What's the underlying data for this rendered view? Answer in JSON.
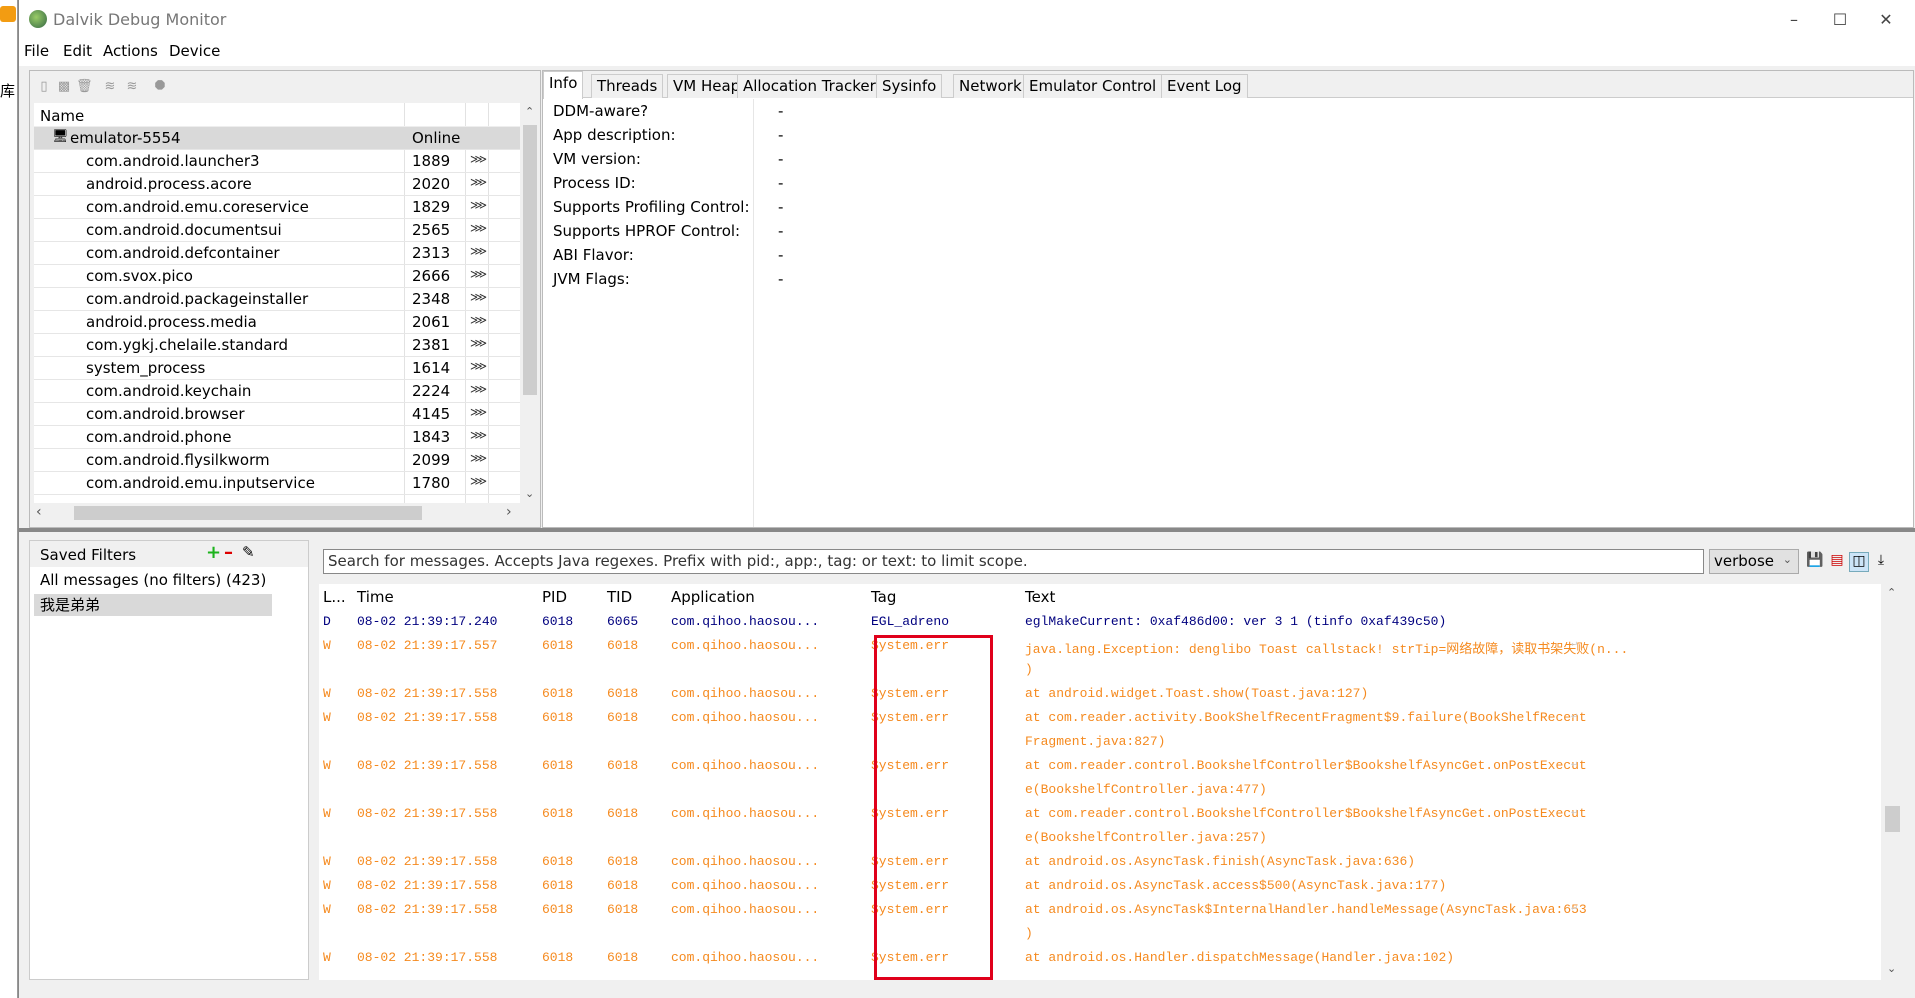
{
  "window": {
    "title": "Dalvik Debug Monitor",
    "background_char": "库"
  },
  "menu": [
    "File",
    "Edit",
    "Actions",
    "Device"
  ],
  "device_toolbar": [
    "debug-icon",
    "update-heap-icon",
    "gc-icon",
    "threads-icon",
    "method-profiling-icon",
    "stop-icon"
  ],
  "devices": {
    "header": "Name",
    "device": {
      "name": "emulator-5554",
      "status": "Online"
    },
    "processes": [
      {
        "name": "com.android.launcher3",
        "pid": "1889"
      },
      {
        "name": "android.process.acore",
        "pid": "2020"
      },
      {
        "name": "com.android.emu.coreservice",
        "pid": "1829"
      },
      {
        "name": "com.android.documentsui",
        "pid": "2565"
      },
      {
        "name": "com.android.defcontainer",
        "pid": "2313"
      },
      {
        "name": "com.svox.pico",
        "pid": "2666"
      },
      {
        "name": "com.android.packageinstaller",
        "pid": "2348"
      },
      {
        "name": "android.process.media",
        "pid": "2061"
      },
      {
        "name": "com.ygkj.chelaile.standard",
        "pid": "2381"
      },
      {
        "name": "system_process",
        "pid": "1614"
      },
      {
        "name": "com.android.keychain",
        "pid": "2224"
      },
      {
        "name": "com.android.browser",
        "pid": "4145"
      },
      {
        "name": "com.android.phone",
        "pid": "1843"
      },
      {
        "name": "com.android.flysilkworm",
        "pid": "2099"
      },
      {
        "name": "com.android.emu.inputservice",
        "pid": "1780"
      }
    ]
  },
  "tabs": [
    "Info",
    "Threads",
    "VM Heap",
    "Allocation Tracker",
    "Sysinfo",
    "Network",
    "Emulator Control",
    "Event Log"
  ],
  "active_tab": "Info",
  "info": [
    {
      "label": "DDM-aware?",
      "value": "-"
    },
    {
      "label": "App description:",
      "value": "-"
    },
    {
      "label": "VM version:",
      "value": "-"
    },
    {
      "label": "Process ID:",
      "value": "-"
    },
    {
      "label": "Supports Profiling Control:",
      "value": "-"
    },
    {
      "label": "Supports HPROF Control:",
      "value": "-"
    },
    {
      "label": "ABI Flavor:",
      "value": "-"
    },
    {
      "label": "JVM Flags:",
      "value": "-"
    }
  ],
  "filters": {
    "title": "Saved Filters",
    "items": [
      "All messages (no filters) (423)",
      "我是弟弟"
    ],
    "selected": 1
  },
  "logcat": {
    "search_placeholder": "Search for messages. Accepts Java regexes. Prefix with pid:, app:, tag: or text: to limit scope.",
    "level": "verbose",
    "columns": [
      "L...",
      "Time",
      "PID",
      "TID",
      "Application",
      "Tag",
      "Text"
    ],
    "colors": {
      "D": "#00007f",
      "W": "#f58a1f",
      "highlight_box": "#e0001b"
    },
    "rows": [
      {
        "level": "D",
        "time": "08-02 21:39:17.240",
        "pid": "6018",
        "tid": "6065",
        "app": "com.qihoo.haosou...",
        "tag": "EGL_adreno",
        "text": [
          "eglMakeCurrent: 0xaf486d00: ver 3 1 (tinfo 0xaf439c50)"
        ]
      },
      {
        "level": "W",
        "time": "08-02 21:39:17.557",
        "pid": "6018",
        "tid": "6018",
        "app": "com.qihoo.haosou...",
        "tag": "System.err",
        "text": [
          "java.lang.Exception: denglibo Toast callstack! strTip=网络故障，读取书架失败(n...",
          ")"
        ]
      },
      {
        "level": "W",
        "time": "08-02 21:39:17.558",
        "pid": "6018",
        "tid": "6018",
        "app": "com.qihoo.haosou...",
        "tag": "System.err",
        "text": [
          "at android.widget.Toast.show(Toast.java:127)"
        ]
      },
      {
        "level": "W",
        "time": "08-02 21:39:17.558",
        "pid": "6018",
        "tid": "6018",
        "app": "com.qihoo.haosou...",
        "tag": "System.err",
        "text": [
          "at com.reader.activity.BookShelfRecentFragment$9.failure(BookShelfRecent",
          "Fragment.java:827)"
        ]
      },
      {
        "level": "W",
        "time": "08-02 21:39:17.558",
        "pid": "6018",
        "tid": "6018",
        "app": "com.qihoo.haosou...",
        "tag": "System.err",
        "text": [
          "at com.reader.control.BookshelfController$BookshelfAsyncGet.onPostExecut",
          "e(BookshelfController.java:477)"
        ]
      },
      {
        "level": "W",
        "time": "08-02 21:39:17.558",
        "pid": "6018",
        "tid": "6018",
        "app": "com.qihoo.haosou...",
        "tag": "System.err",
        "text": [
          "at com.reader.control.BookshelfController$BookshelfAsyncGet.onPostExecut",
          "e(BookshelfController.java:257)"
        ]
      },
      {
        "level": "W",
        "time": "08-02 21:39:17.558",
        "pid": "6018",
        "tid": "6018",
        "app": "com.qihoo.haosou...",
        "tag": "System.err",
        "text": [
          "at android.os.AsyncTask.finish(AsyncTask.java:636)"
        ]
      },
      {
        "level": "W",
        "time": "08-02 21:39:17.558",
        "pid": "6018",
        "tid": "6018",
        "app": "com.qihoo.haosou...",
        "tag": "System.err",
        "text": [
          "at android.os.AsyncTask.access$500(AsyncTask.java:177)"
        ]
      },
      {
        "level": "W",
        "time": "08-02 21:39:17.558",
        "pid": "6018",
        "tid": "6018",
        "app": "com.qihoo.haosou...",
        "tag": "System.err",
        "text": [
          "at android.os.AsyncTask$InternalHandler.handleMessage(AsyncTask.java:653",
          ")"
        ]
      },
      {
        "level": "W",
        "time": "08-02 21:39:17.558",
        "pid": "6018",
        "tid": "6018",
        "app": "com.qihoo.haosou...",
        "tag": "System.err",
        "text": [
          "at android.os.Handler.dispatchMessage(Handler.java:102)"
        ]
      }
    ]
  }
}
